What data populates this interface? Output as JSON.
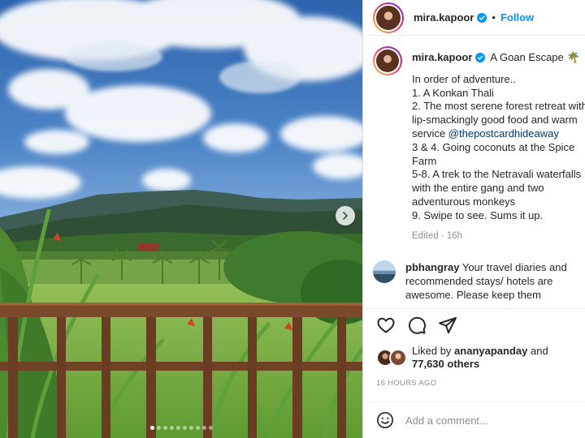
{
  "post": {
    "image_alt": "Panoramic view from a wooden balcony over a green valley with palms, forested mountains and a blue sky with clouds",
    "carousel": {
      "slide_count": 10,
      "active_slide": 1
    },
    "next_icon": "chevron-right-icon"
  },
  "header": {
    "username": "mira.kapoor",
    "verified_icon": "verified-badge-icon",
    "separator": "•",
    "follow_label": "Follow"
  },
  "caption": {
    "username": "mira.kapoor",
    "title": "A Goan Escape",
    "title_emoji": "🌴",
    "lines": [
      "In order of adventure..",
      "1. A Konkan Thali",
      "2. The most serene forest retreat with",
      "lip-smackingly good food and warm"
    ],
    "service_prefix": "service ",
    "mention": "@thepostcardhideaway",
    "lines_after": [
      "3 & 4. Going coconuts at the Spice",
      "Farm",
      "5-8. A trek to the Netravali waterfalls",
      "with the entire gang and two",
      "adventurous monkeys",
      "9. Swipe to see. Sums it up."
    ],
    "edited": "Edited · 16h"
  },
  "comment": {
    "username": "pbhangray",
    "text_line1": " Your travel diaries and",
    "text_line2": "recommended stays/ hotels are",
    "text_line3": "awesome. Please keep them"
  },
  "actions": {
    "like_icon": "heart-icon",
    "comment_icon": "comment-bubble-icon",
    "share_icon": "paper-plane-icon"
  },
  "likes": {
    "prefix": "Liked by ",
    "liker": "ananyapanday",
    "connector": " and",
    "others": "77,630 others"
  },
  "timestamp": "16 HOURS AGO",
  "add_comment": {
    "emoji_icon": "smiley-icon",
    "placeholder": "Add a comment..."
  },
  "colors": {
    "accent": "#0095f6",
    "mention": "#00376b",
    "muted": "#8e8e8e",
    "border": "#dbdbdb"
  }
}
